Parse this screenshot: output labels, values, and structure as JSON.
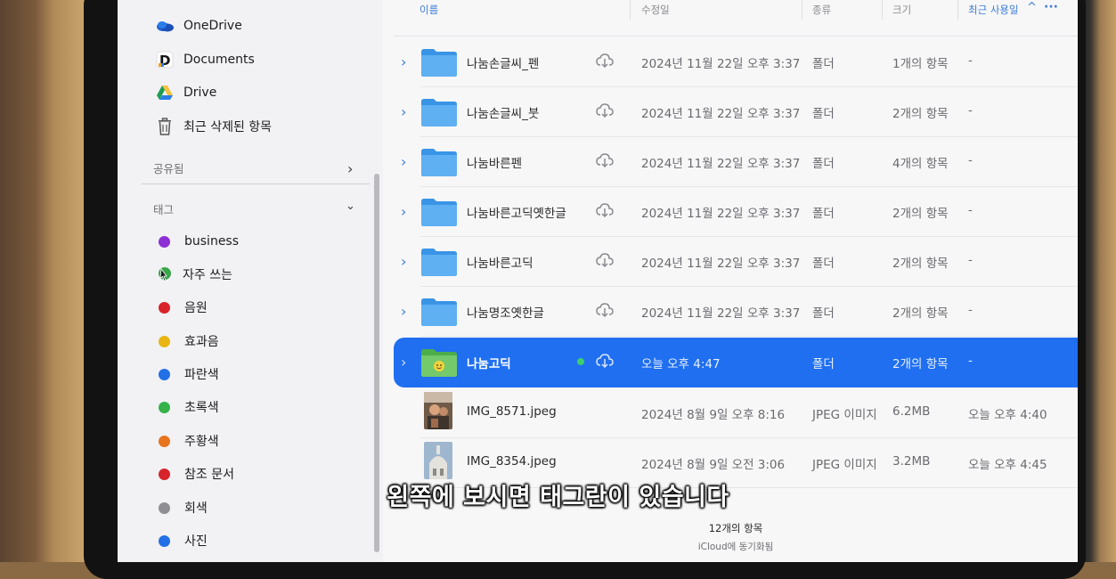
{
  "sidebar": {
    "locations": [
      {
        "label": "OneDrive",
        "icon": "onedrive-icon"
      },
      {
        "label": "Documents",
        "icon": "documents-app-icon"
      },
      {
        "label": "Drive",
        "icon": "google-drive-icon"
      },
      {
        "label": "최근 삭제된 항목",
        "icon": "trash-icon"
      }
    ],
    "shared_section": "공유됨",
    "tags_section": "태그",
    "tags": [
      {
        "label": "business",
        "color": "#8e2fd6"
      },
      {
        "label": "자주 쓰는",
        "color": "#3aa64a"
      },
      {
        "label": "음원",
        "color": "#d8232a"
      },
      {
        "label": "효과음",
        "color": "#e8b512"
      },
      {
        "label": "파란색",
        "color": "#2270e6"
      },
      {
        "label": "초록색",
        "color": "#36b24a"
      },
      {
        "label": "주황색",
        "color": "#e8741e"
      },
      {
        "label": "참조 문서",
        "color": "#d8232a"
      },
      {
        "label": "회색",
        "color": "#8e8e93"
      },
      {
        "label": "사진",
        "color": "#2270e6"
      }
    ]
  },
  "columns": {
    "name": "이름",
    "modified": "수정일",
    "kind": "종류",
    "size": "크기",
    "recent": "최근 사용일",
    "sort_indicator": "^",
    "more": "···"
  },
  "files": [
    {
      "name": "나눔손글씨_펜",
      "date": "2024년 11월 22일 오후 3:37",
      "kind": "폴더",
      "size": "1개의 항목",
      "recent": "-",
      "type": "folder"
    },
    {
      "name": "나눔손글씨_붓",
      "date": "2024년 11월 22일 오후 3:37",
      "kind": "폴더",
      "size": "2개의 항목",
      "recent": "-",
      "type": "folder"
    },
    {
      "name": "나눔바른펜",
      "date": "2024년 11월 22일 오후 3:37",
      "kind": "폴더",
      "size": "4개의 항목",
      "recent": "-",
      "type": "folder"
    },
    {
      "name": "나눔바른고딕옛한글",
      "date": "2024년 11월 22일 오후 3:37",
      "kind": "폴더",
      "size": "2개의 항목",
      "recent": "-",
      "type": "folder"
    },
    {
      "name": "나눔바른고딕",
      "date": "2024년 11월 22일 오후 3:37",
      "kind": "폴더",
      "size": "2개의 항목",
      "recent": "-",
      "type": "folder"
    },
    {
      "name": "나눔명조옛한글",
      "date": "2024년 11월 22일 오후 3:37",
      "kind": "폴더",
      "size": "2개의 항목",
      "recent": "-",
      "type": "folder"
    },
    {
      "name": "나눔고딕",
      "date": "오늘 오후 4:47",
      "kind": "폴더",
      "size": "2개의 항목",
      "recent": "-",
      "type": "folder-tagged",
      "selected": true
    },
    {
      "name": "IMG_8571.jpeg",
      "date": "2024년 8월 9일 오후 8:16",
      "kind": "JPEG 이미지",
      "size": "6.2MB",
      "recent": "오늘 오후 4:40",
      "type": "image"
    },
    {
      "name": "IMG_8354.jpeg",
      "date": "2024년 8월 9일 오전 3:06",
      "kind": "JPEG 이미지",
      "size": "3.2MB",
      "recent": "오늘 오후 4:45",
      "type": "image"
    }
  ],
  "footer": {
    "count": "12개의 항목",
    "sync": "iCloud에 동기화됨"
  },
  "subtitle": "왼쪽에 보시면 태그란이 있습니다"
}
